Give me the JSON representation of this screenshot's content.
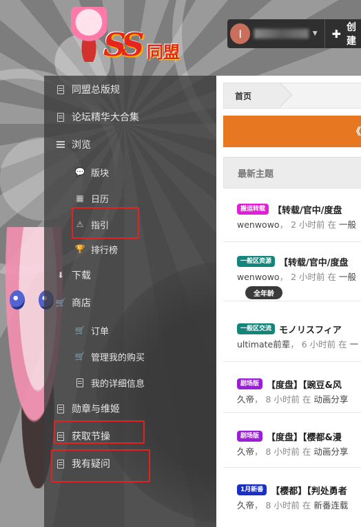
{
  "logo": {
    "ss": "SS",
    "name": "同盟"
  },
  "user": {
    "avatar_letter": "I",
    "name": "",
    "create_label": "创建"
  },
  "sidebar": {
    "items": [
      {
        "label": "同盟总版规"
      },
      {
        "label": "论坛精华大合集"
      },
      {
        "label": "浏览"
      },
      {
        "label": "版块"
      },
      {
        "label": "日历"
      },
      {
        "label": "指引"
      },
      {
        "label": "排行榜"
      },
      {
        "label": "下载"
      },
      {
        "label": "商店"
      },
      {
        "label": "订单"
      },
      {
        "label": "管理我的购买"
      },
      {
        "label": "我的详细信息"
      },
      {
        "label": "勋章与维姬"
      },
      {
        "label": "获取节操"
      },
      {
        "label": "我有疑问"
      }
    ]
  },
  "breadcrumb": {
    "home": "首页"
  },
  "banner": {
    "text": "《同"
  },
  "latest": {
    "heading": "最新主题"
  },
  "topics": [
    {
      "badge": "搬运转载",
      "badge_color": "#e01fd6",
      "title": "【转载/官中/度盘",
      "author": "wenwowo",
      "time": "2 小时前",
      "in": "在",
      "category": "一般"
    },
    {
      "badge": "一般区资源",
      "badge_color": "#14857a",
      "title": "【转载/官中/度盘",
      "author": "wenwowo",
      "time": "2 小时前",
      "in": "在",
      "category": "一般",
      "tag": "全年龄"
    },
    {
      "badge": "一般区交流",
      "badge_color": "#14857a",
      "title": "モノリスフィア",
      "author": "ultimate前辈",
      "time": "6 小时前",
      "in": "在",
      "category": "一"
    },
    {
      "badge": "剧场版",
      "badge_color": "#9b1fd6",
      "title": "【度盘】【豌豆&风",
      "author": "久帝",
      "time": "8 小时前",
      "in": "在",
      "category": "动画分享"
    },
    {
      "badge": "剧场版",
      "badge_color": "#9b1fd6",
      "title": "【度盘】【樱都&漫",
      "author": "久帝",
      "time": "8 小时前",
      "in": "在",
      "category": "动画分享"
    },
    {
      "badge": "1月新番",
      "badge_color": "#1a2fc4",
      "title": "【樱都】【判处勇者",
      "author": "久帝",
      "time": "8 小时前",
      "in": "在",
      "category": "新番连载"
    }
  ],
  "colors": {
    "highlight": "#e52222",
    "banner": "#e87722"
  }
}
